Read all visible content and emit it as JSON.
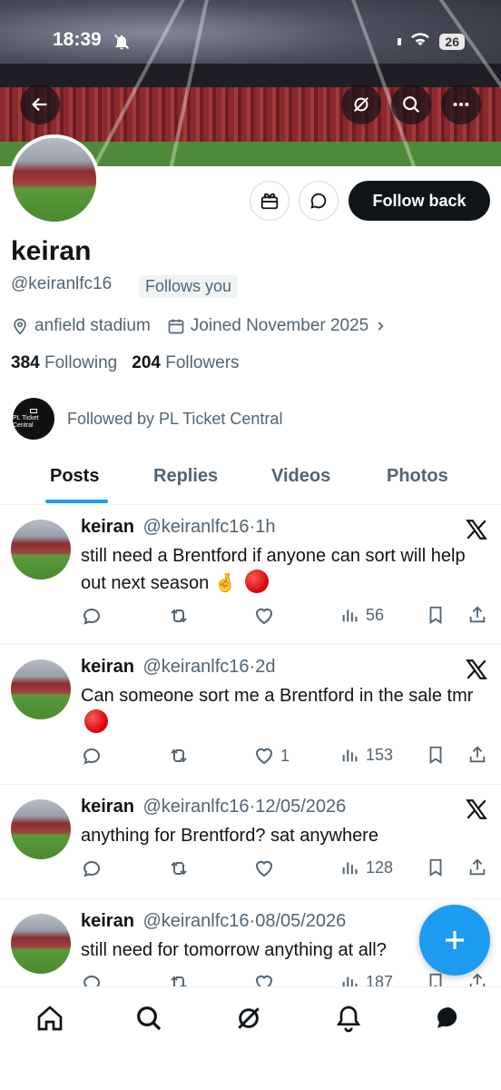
{
  "status_bar": {
    "time": "18:39",
    "battery": "26"
  },
  "profile": {
    "display_name": "keiran",
    "handle": "@keiranlfc16",
    "follows_you": "Follows you",
    "location": "anfield stadium",
    "joined": "Joined November 2025",
    "following_count": "384",
    "following_label": "Following",
    "followers_count": "204",
    "followers_label": "Followers",
    "followed_by": "Followed by PL Ticket Central",
    "followed_by_avatar_text": "PL Ticket Central"
  },
  "actions": {
    "follow_back": "Follow back"
  },
  "tabs": [
    {
      "label": "Posts",
      "active": true
    },
    {
      "label": "Replies"
    },
    {
      "label": "Videos"
    },
    {
      "label": "Photos"
    }
  ],
  "tweets": [
    {
      "name": "keiran",
      "handle": "@keiranlfc16",
      "sep": "·",
      "time": "1h",
      "text_a": "still need a Brentford if anyone can sort will help out next season",
      "emoji_a": "🤞",
      "likes": "",
      "views": "56"
    },
    {
      "name": "keiran",
      "handle": "@keiranlfc16",
      "sep": "·",
      "time": "2d",
      "text_a": "Can someone sort me a Brentford in the sale tmr",
      "likes": "1",
      "views": "153"
    },
    {
      "name": "keiran",
      "handle": "@keiranlfc16",
      "sep": "·",
      "time": "12/05/2026",
      "text_a": "anything for Brentford? sat anywhere",
      "likes": "",
      "views": "128"
    },
    {
      "name": "keiran",
      "handle": "@keiranlfc16",
      "sep": "·",
      "time": "08/05/2026",
      "text_a": "still need for tomorrow anything at all?",
      "likes": "",
      "views": "187"
    }
  ],
  "colors": {
    "accent": "#1d9bf0",
    "text": "#0f1419",
    "muted": "#536471"
  }
}
